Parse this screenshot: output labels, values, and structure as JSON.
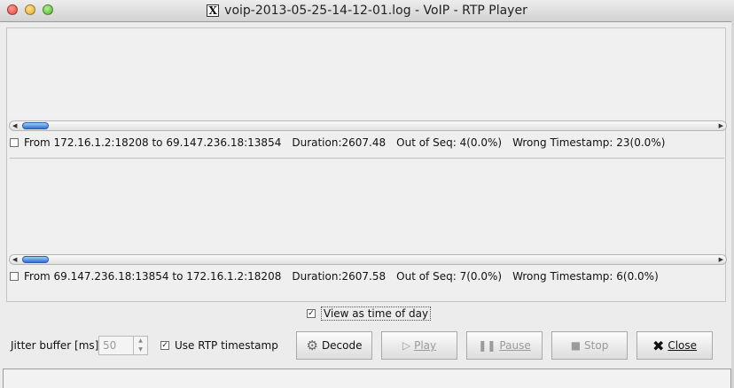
{
  "window": {
    "title": "voip-2013-05-25-14-12-01.log - VoIP - RTP Player",
    "app_icon": "x11-icon"
  },
  "streams": [
    {
      "description": "From 172.16.1.2:18208 to 69.147.236.18:13854",
      "duration": "Duration:2607.48",
      "out_of_seq": "Out of Seq: 4(0.0%)",
      "wrong_timestamp": "Wrong Timestamp: 23(0.0%)",
      "selected": false
    },
    {
      "description": "From 69.147.236.18:13854 to 172.16.1.2:18208",
      "duration": "Duration:2607.58",
      "out_of_seq": "Out of Seq: 7(0.0%)",
      "wrong_timestamp": "Wrong Timestamp: 6(0.0%)",
      "selected": false
    }
  ],
  "view_as_time_of_day": {
    "label": "View as time of day",
    "checked": true
  },
  "controls": {
    "jitter_label": "Jitter buffer [ms]",
    "jitter_value": "50",
    "use_rtp_label": "Use RTP timestamp",
    "use_rtp_checked": true,
    "decode_label": "Decode",
    "play_label": "Play",
    "pause_label": "Pause",
    "stop_label": "Stop",
    "close_label": "Close"
  },
  "colors": {
    "scroll_thumb": "#2e6fd6",
    "window_bg": "#ececec"
  }
}
